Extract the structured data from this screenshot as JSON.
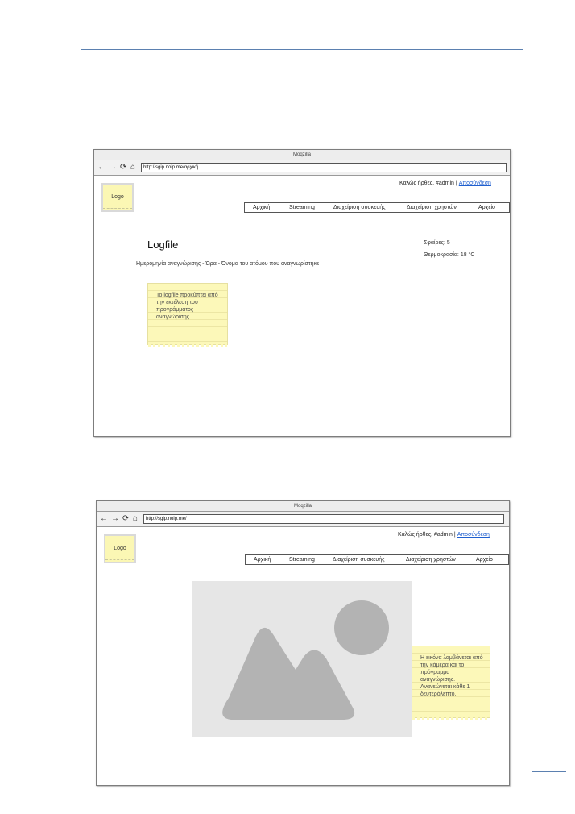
{
  "mockup1": {
    "window_title": "Moqzilla",
    "url": "http://sgip.noip.me/αρχική",
    "logo": "Logo",
    "welcome": "Καλώς ήρθες, #admin",
    "separator": "|",
    "logout": "Αποσύνδεση",
    "menu": [
      "Αρχική",
      "Streaming",
      "Διαχείριση συσκευής",
      "Διαχείριση χρηστών",
      "Αρχείο"
    ],
    "heading": "Logfile",
    "spheres": "Σφαίρες: 5",
    "temperature": "Θερμοκρασία: 18 °C",
    "log_format": "Ημερομηνία αναγνώρισης - Ώρα - Όνομα του ατόμου που αναγνωρίστηκε",
    "note": "Το logfile προκύπτει από την εκτέλεση του προγράμματος αναγνώρισης"
  },
  "mockup2": {
    "window_title": "Moqzilla",
    "url": "http://sgip.noip.me/",
    "logo": "Logo",
    "welcome": "Καλώς ήρθες, #admin",
    "separator": "|",
    "logout": "Αποσύνδεση",
    "menu": [
      "Αρχική",
      "Streaming",
      "Διαχείριση συσκευής",
      "Διαχείριση χρηστών",
      "Αρχείο"
    ],
    "image_icon": "image-placeholder-icon",
    "note": "Η εικόνα λαμβάνεται από την κάμερα και το πρόγραμμα αναγνώρισης. Ανανεώνεται κάθε 1 δευτερόλεπτο."
  },
  "icons": {
    "back": "←",
    "forward": "→",
    "reload": "⟳",
    "home": "⌂"
  },
  "colors": {
    "link": "#1f5fcf",
    "sticky": "#fcf8b9",
    "rule": "#5b80b0"
  }
}
